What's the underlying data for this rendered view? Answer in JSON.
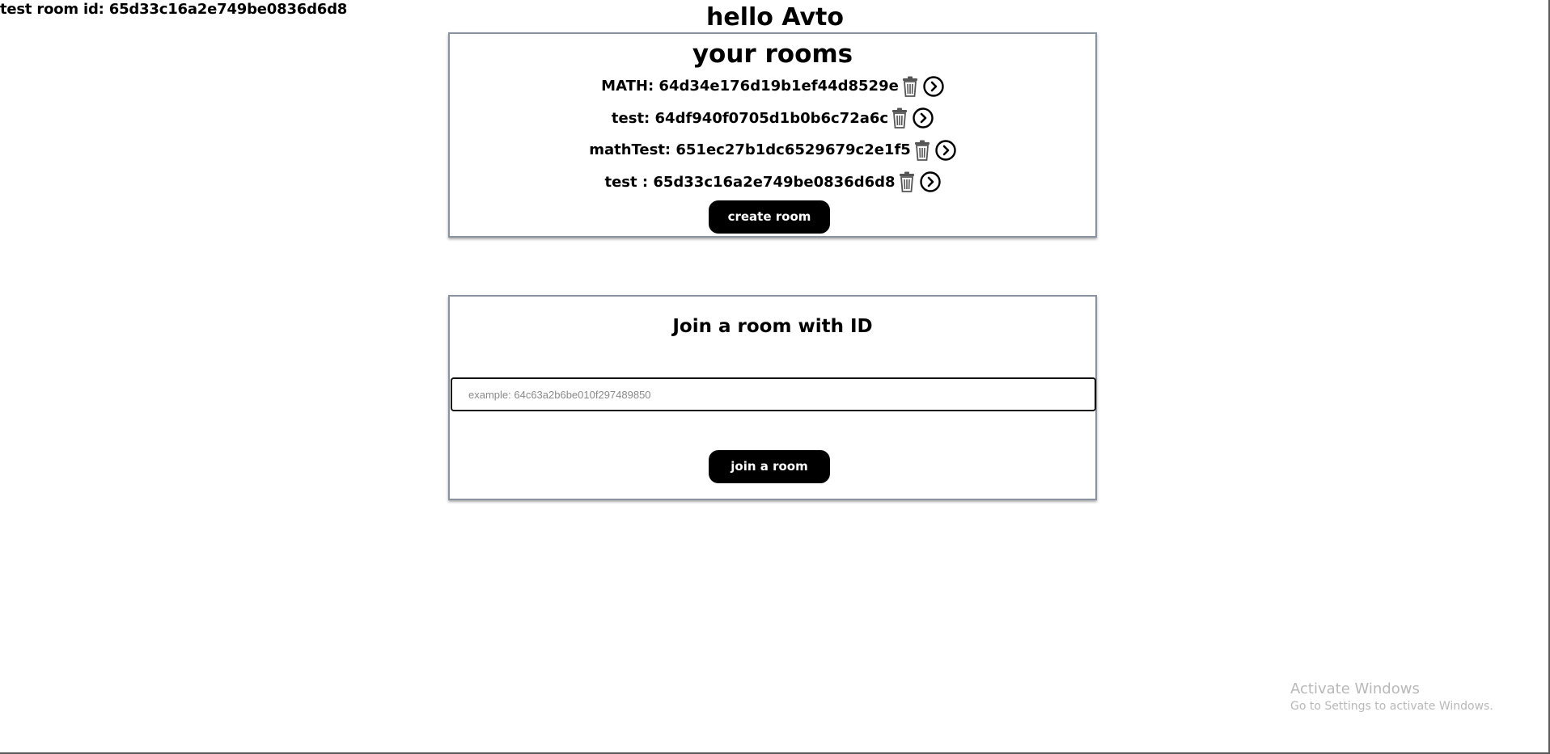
{
  "header": {
    "test_room_label": "test room id: 65d33c16a2e749be0836d6d8",
    "greeting": "hello Avto"
  },
  "rooms": {
    "title": "your rooms",
    "items": [
      {
        "label": "MATH: 64d34e176d19b1ef44d8529e"
      },
      {
        "label": "test: 64df940f0705d1b0b6c72a6c"
      },
      {
        "label": "mathTest: 651ec27b1dc6529679c2e1f5"
      },
      {
        "label": "test : 65d33c16a2e749be0836d6d8"
      }
    ],
    "item_icons": [
      "trash-icon",
      "chevron-right-circle-icon"
    ],
    "create_button": "create room"
  },
  "join": {
    "title": "Join a room with ID",
    "input_placeholder": "example: 64c63a2b6be010f297489850",
    "input_value": "",
    "button": "join a room"
  },
  "watermark": {
    "title": "Activate Windows",
    "subtitle": "Go to Settings to activate Windows."
  },
  "colors": {
    "button_bg": "#000000",
    "button_text": "#ffffff",
    "panel_border": "#8a94a0",
    "watermark": "#b8b8b8"
  }
}
